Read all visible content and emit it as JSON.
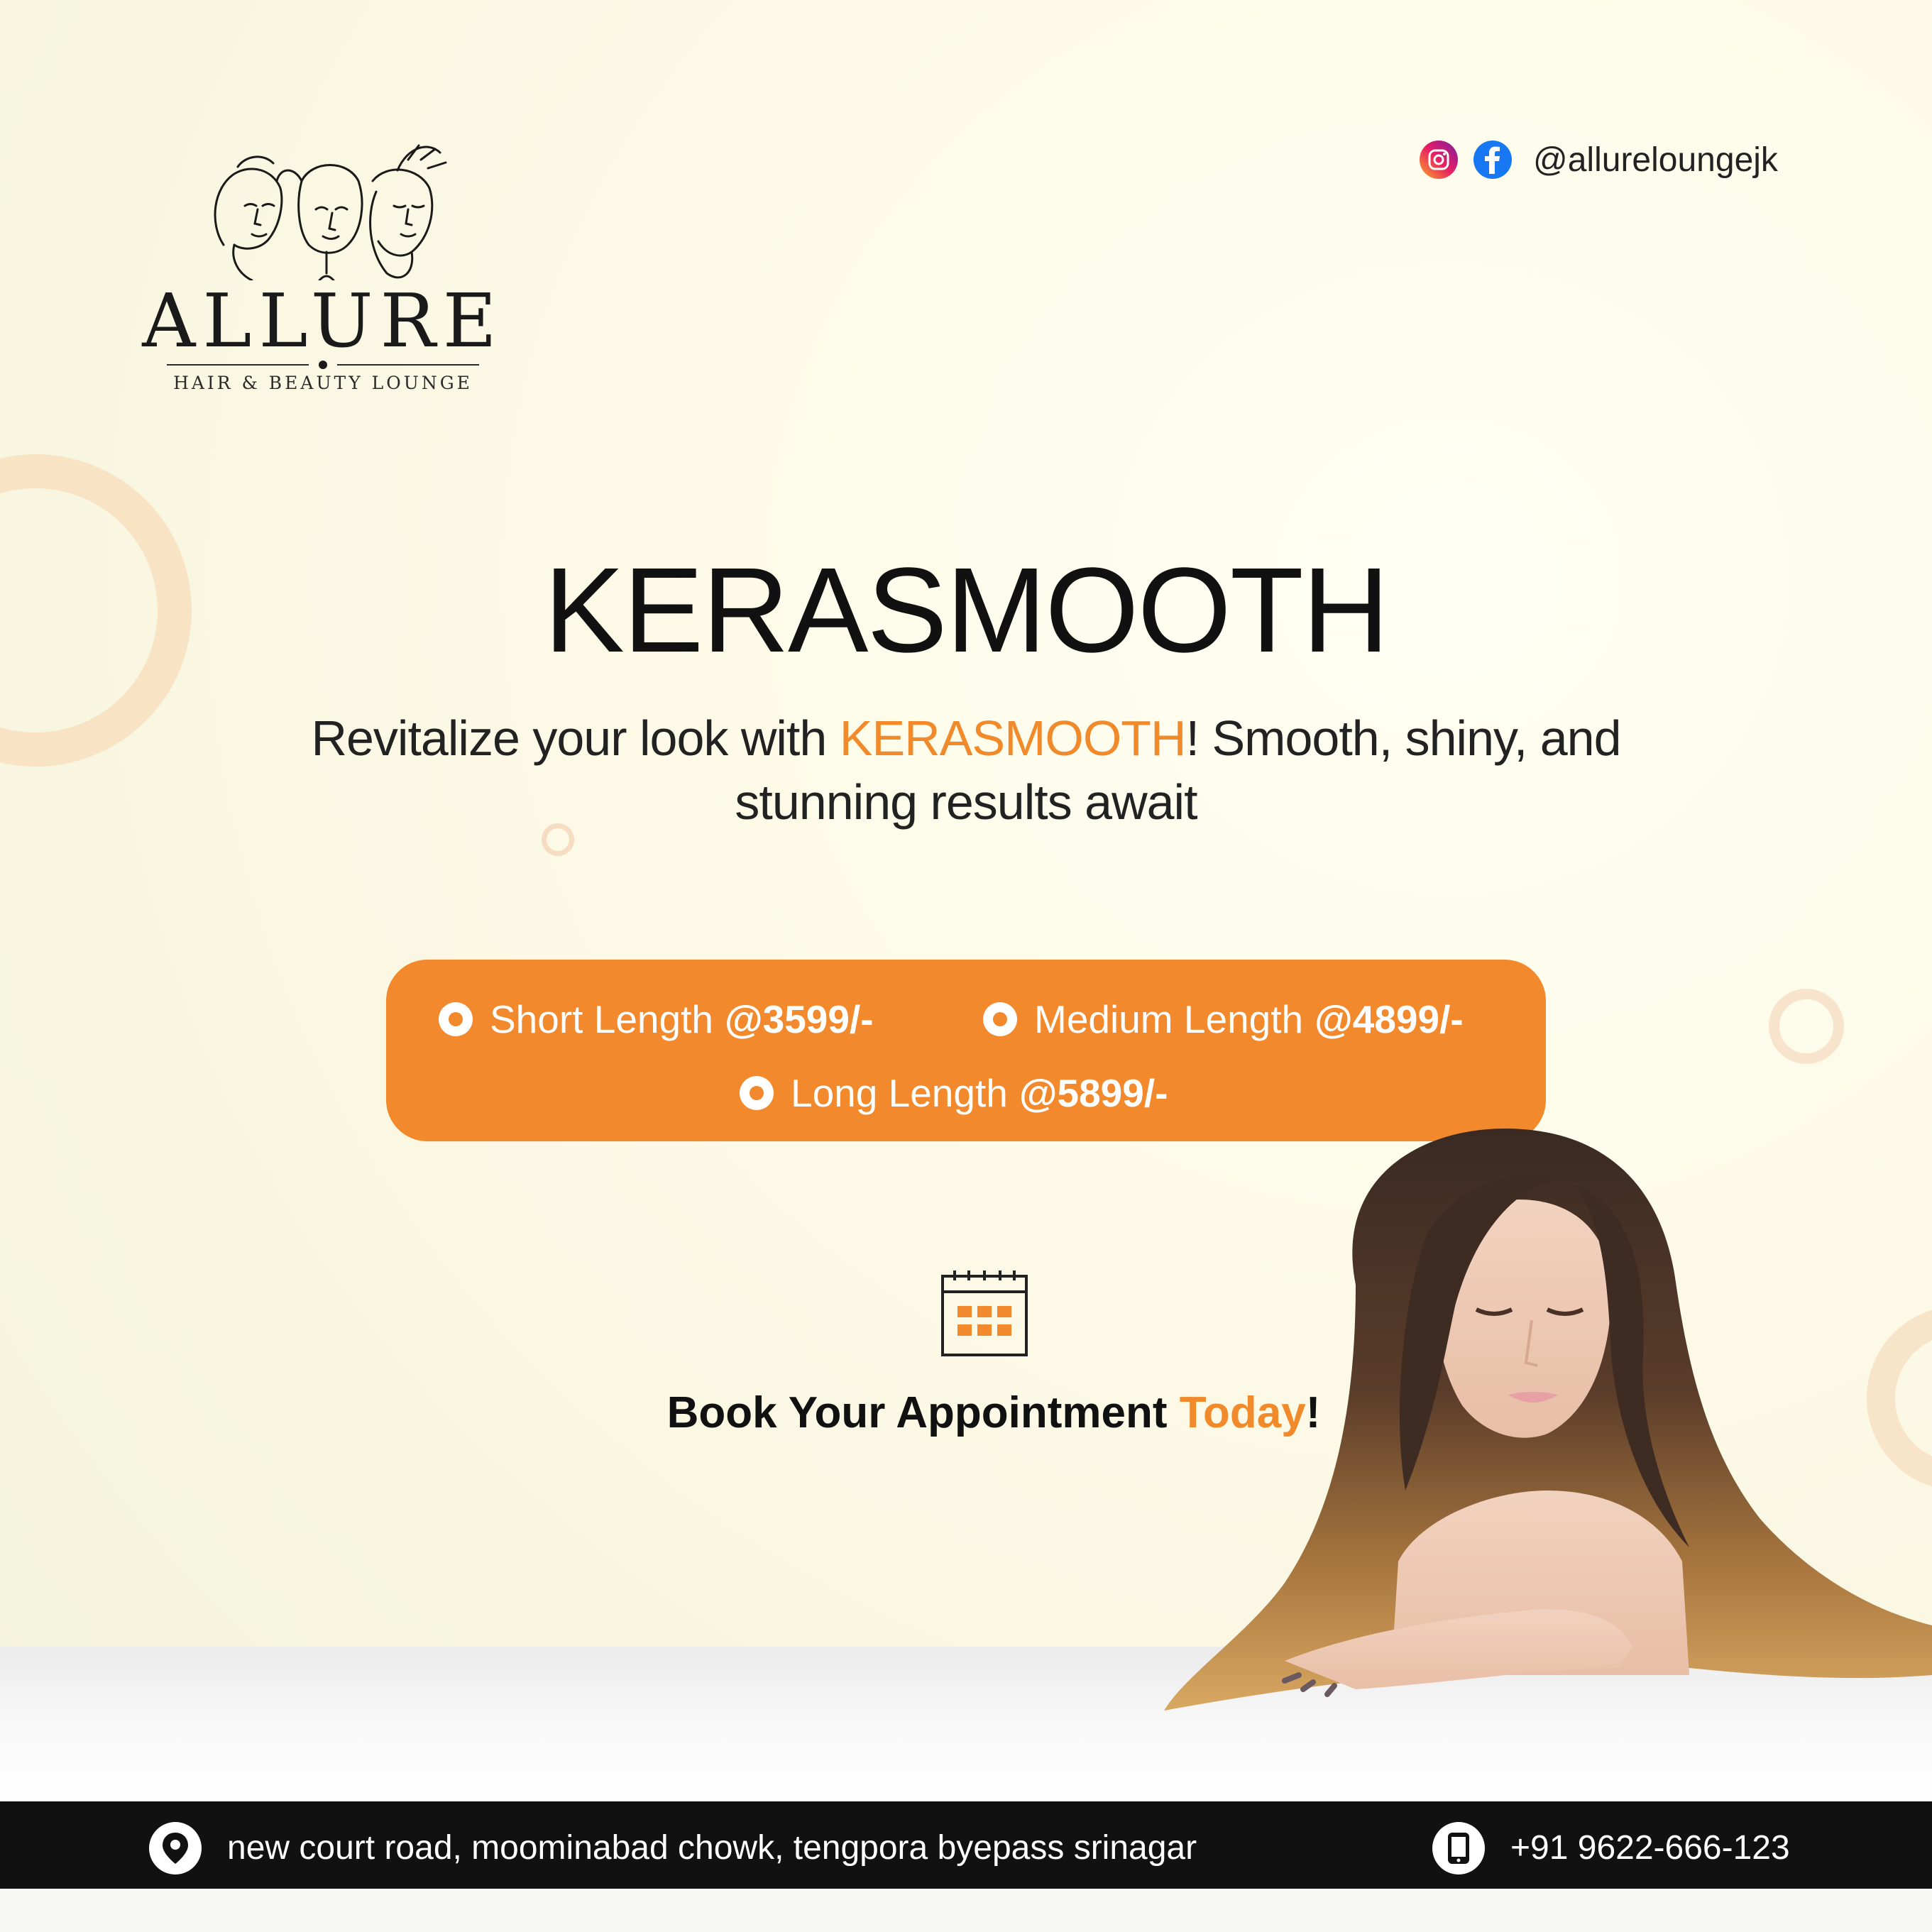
{
  "brand": {
    "name": "ALLURE",
    "tagline": "HAIR & BEAUTY LOUNGE"
  },
  "social": {
    "handle": "@allureloungejk",
    "icons": [
      "instagram-icon",
      "facebook-icon"
    ]
  },
  "headline": {
    "title": "KERASMOOTH",
    "subtitle_part1": "Revitalize your look with ",
    "subtitle_highlight": "KERASMOOTH",
    "subtitle_part2": "! Smooth, shiny, and stunning results await"
  },
  "prices": [
    {
      "label": "Short Length",
      "value": "@3599/-"
    },
    {
      "label": "Medium Length",
      "value": "@4899/-"
    },
    {
      "label": "Long Length",
      "value": "@5899/-"
    }
  ],
  "cta": {
    "prefix": "Book Your Appointment ",
    "highlight": "Today",
    "suffix": "!"
  },
  "footer": {
    "address": "new court road, moominabad chowk, tengpora byepass srinagar",
    "phone": "+91 9622-666-123"
  },
  "colors": {
    "accent": "#f2892c",
    "text": "#111111",
    "footer_bg": "#111111",
    "background": "#fdfbe8"
  }
}
